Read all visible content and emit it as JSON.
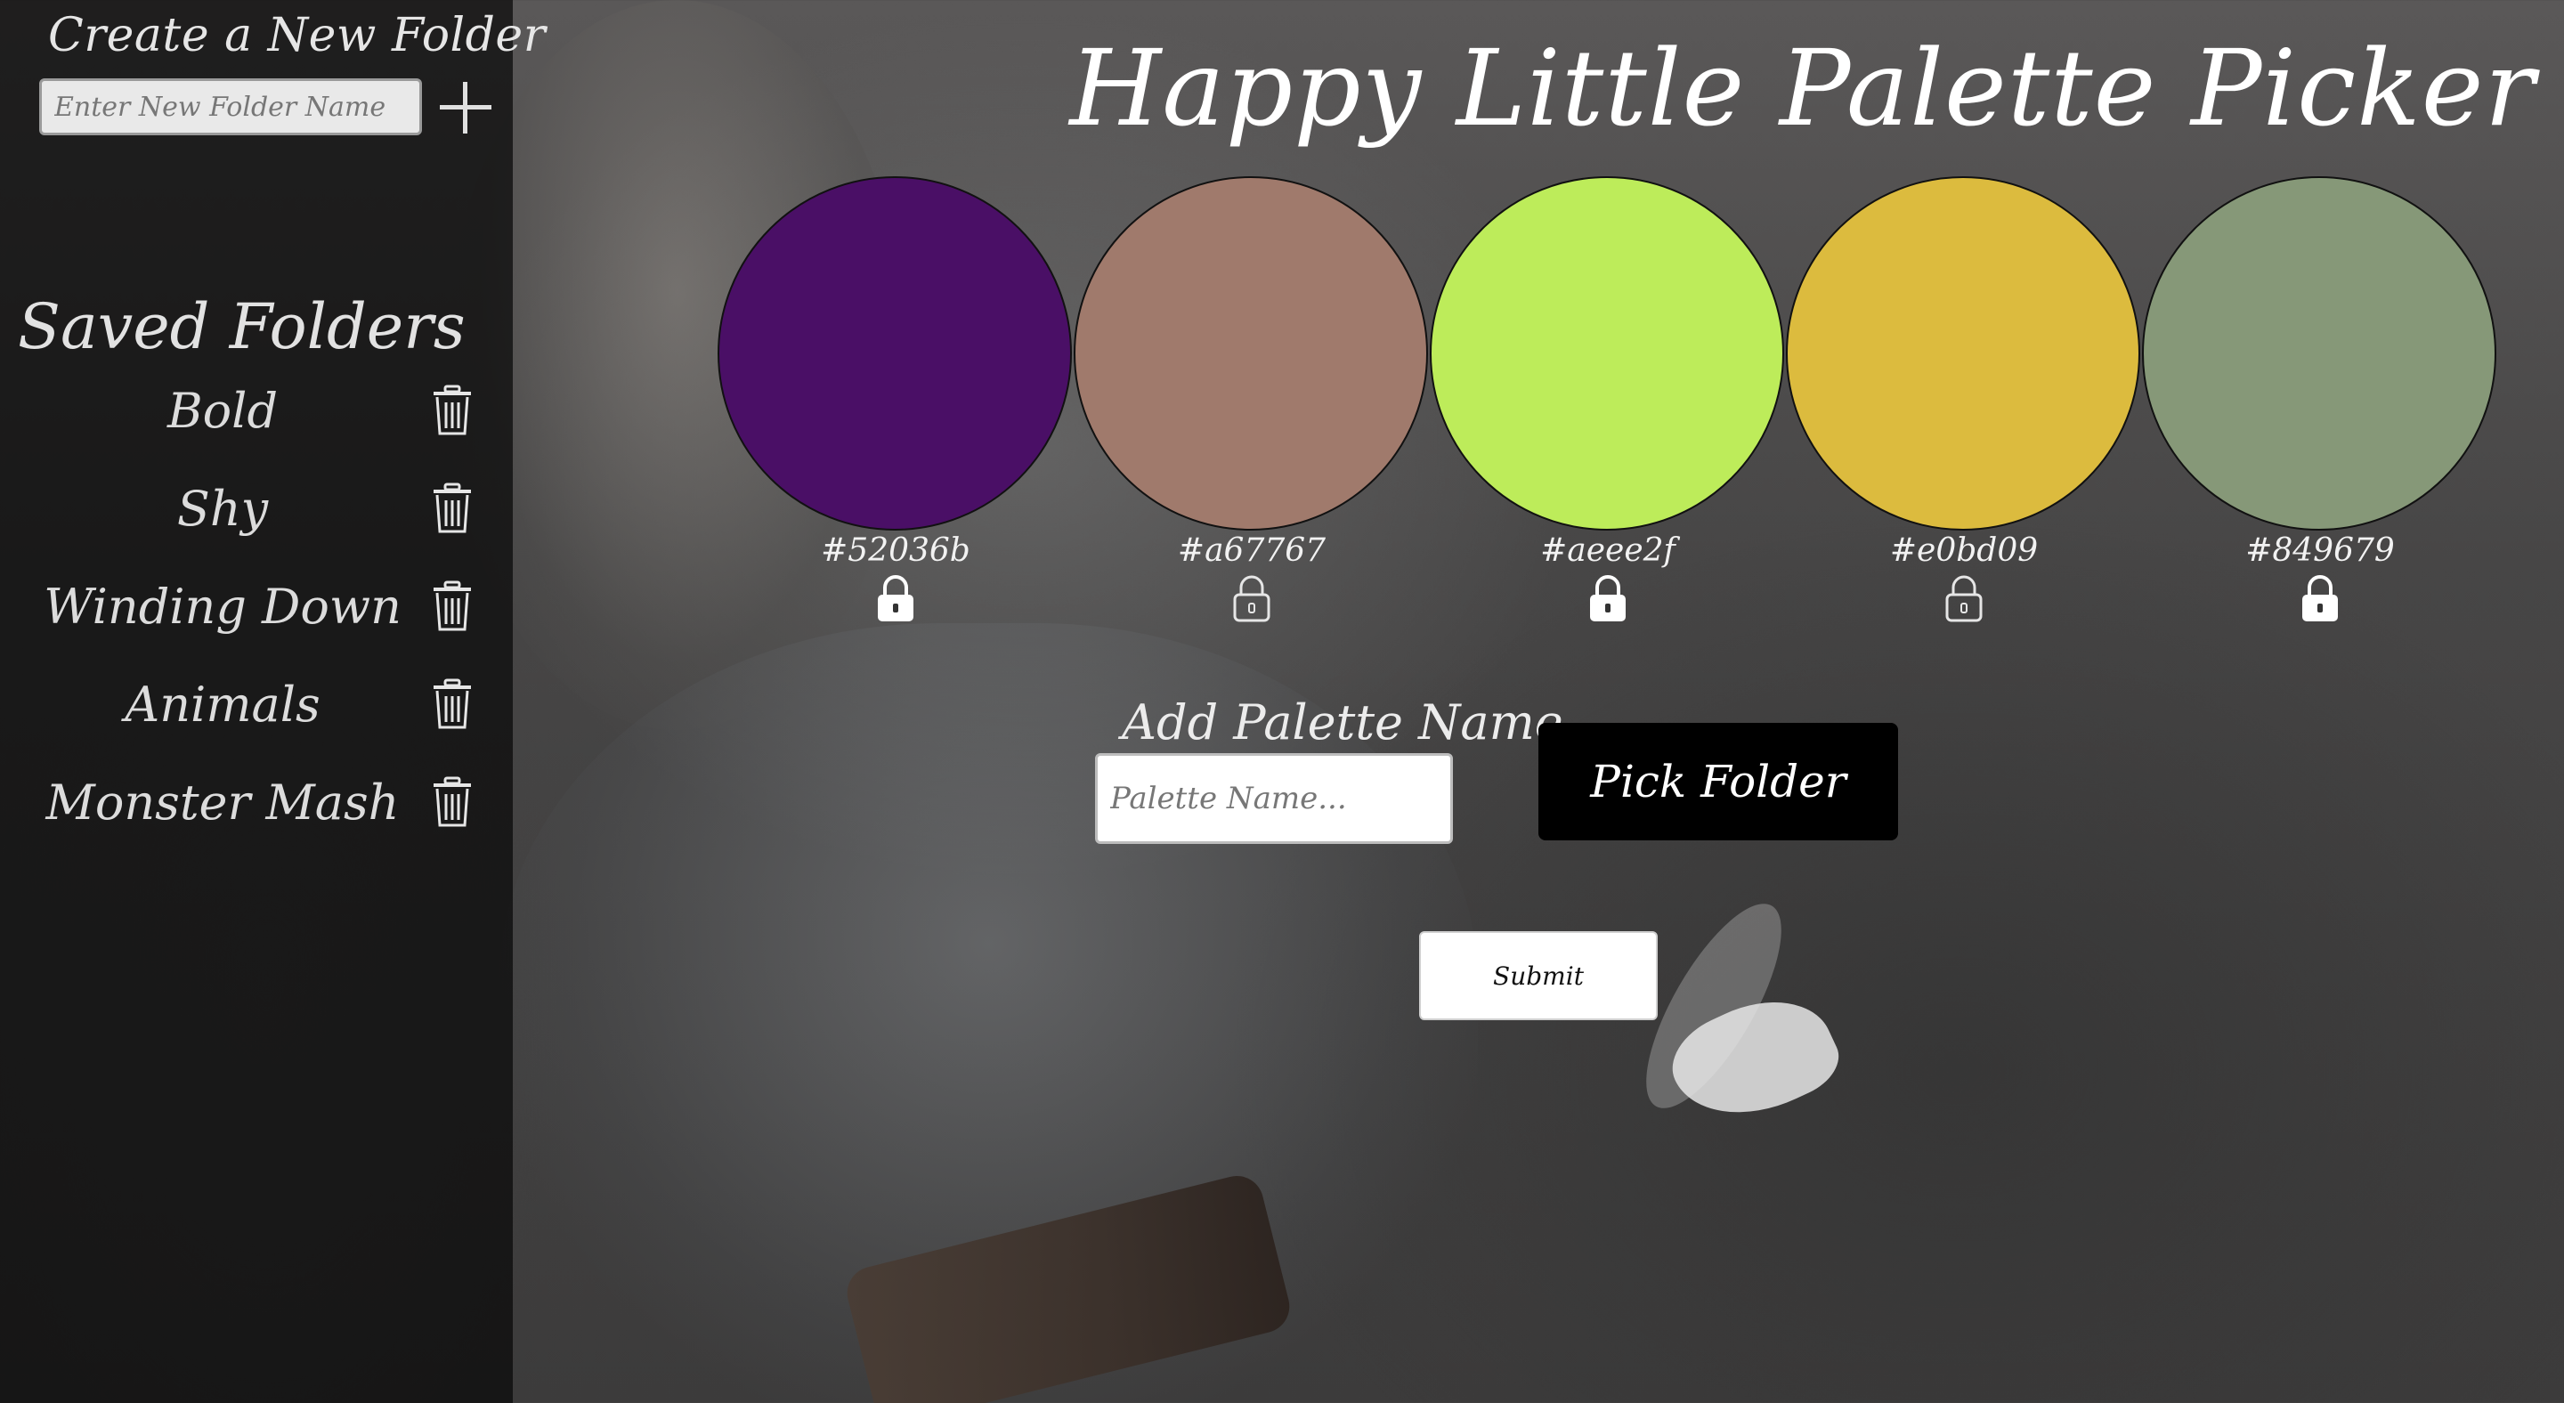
{
  "sidebar": {
    "create_heading": "Create a New Folder",
    "folder_input_placeholder": "Enter New Folder Name",
    "add_icon": "plus-icon",
    "saved_heading": "Saved Folders",
    "folders": [
      {
        "name": "Bold"
      },
      {
        "name": "Shy"
      },
      {
        "name": "Winding Down"
      },
      {
        "name": "Animals"
      },
      {
        "name": "Monster Mash"
      }
    ],
    "delete_icon": "trash-icon"
  },
  "main": {
    "title": "Happy Little Palette Picker",
    "swatches": [
      {
        "hex": "#52036b",
        "color": "#4a0f66",
        "locked": true
      },
      {
        "hex": "#a67767",
        "color": "#a07a6c",
        "locked": false
      },
      {
        "hex": "#aeee2f",
        "color": "#bdec5a",
        "locked": true
      },
      {
        "hex": "#e0bd09",
        "color": "#dcbb3e",
        "locked": false
      },
      {
        "hex": "#849679",
        "color": "#869878",
        "locked": true
      }
    ],
    "palette_label": "Add Palette Name",
    "palette_placeholder": "Palette Name...",
    "pick_folder_label": "Pick Folder",
    "submit_label": "Submit"
  }
}
